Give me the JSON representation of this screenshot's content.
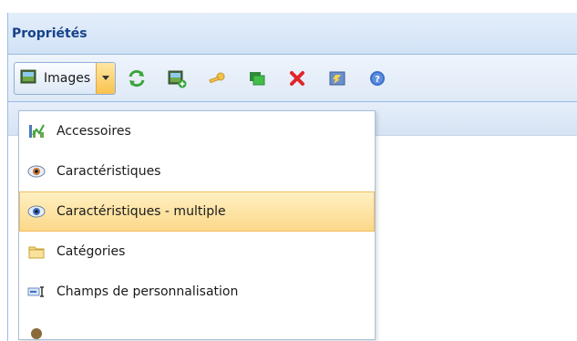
{
  "panel": {
    "title": "Propriétés"
  },
  "toolbar": {
    "split_button": {
      "label": "Images",
      "icon": "image-icon"
    },
    "icons": [
      "refresh-icon",
      "add-image-icon",
      "key-icon",
      "copy-icon",
      "delete-icon",
      "edit-icon",
      "help-icon"
    ],
    "colors": {
      "refresh": "#3aa33a",
      "delete": "#e0262b",
      "help": "#3b70c8"
    }
  },
  "menu": {
    "items": [
      {
        "label": "Accessoires",
        "icon": "chart-icon",
        "active": false
      },
      {
        "label": "Caractéristiques",
        "icon": "eye-icon",
        "active": false
      },
      {
        "label": "Caractéristiques - multiple",
        "icon": "eye-icon",
        "active": true
      },
      {
        "label": "Catégories",
        "icon": "folder-icon",
        "active": false
      },
      {
        "label": "Champs de personnalisation",
        "icon": "text-field-icon",
        "active": false
      }
    ]
  }
}
